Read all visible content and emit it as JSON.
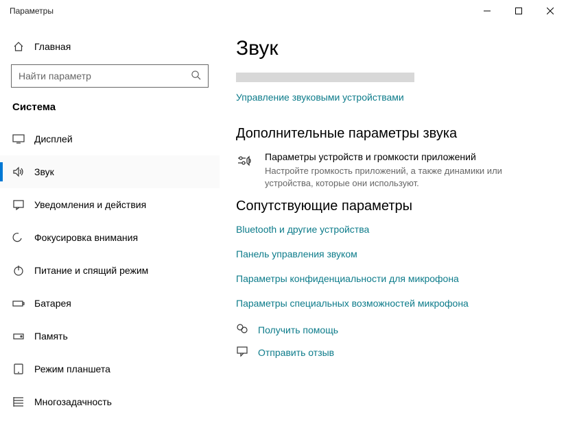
{
  "window": {
    "title": "Параметры"
  },
  "sidebar": {
    "home": "Главная",
    "search_placeholder": "Найти параметр",
    "heading": "Система",
    "items": [
      {
        "label": "Дисплей",
        "icon": "display"
      },
      {
        "label": "Звук",
        "icon": "sound",
        "selected": true
      },
      {
        "label": "Уведомления и действия",
        "icon": "notifications"
      },
      {
        "label": "Фокусировка внимания",
        "icon": "focus"
      },
      {
        "label": "Питание и спящий режим",
        "icon": "power"
      },
      {
        "label": "Батарея",
        "icon": "battery"
      },
      {
        "label": "Память",
        "icon": "storage"
      },
      {
        "label": "Режим планшета",
        "icon": "tablet"
      },
      {
        "label": "Многозадачность",
        "icon": "multitask"
      }
    ]
  },
  "main": {
    "title": "Звук",
    "manage_devices_link": "Управление звуковыми устройствами",
    "advanced": {
      "heading": "Дополнительные параметры звука",
      "item_title": "Параметры устройств и громкости приложений",
      "item_desc": "Настройте громкость приложений, а также динамики или устройства, которые они используют."
    },
    "related": {
      "heading": "Сопутствующие параметры",
      "links": [
        "Bluetooth и другие устройства",
        "Панель управления звуком",
        "Параметры конфиденциальности для микрофона",
        "Параметры специальных возможностей микрофона"
      ]
    },
    "help": {
      "get_help": "Получить помощь",
      "feedback": "Отправить отзыв"
    }
  }
}
